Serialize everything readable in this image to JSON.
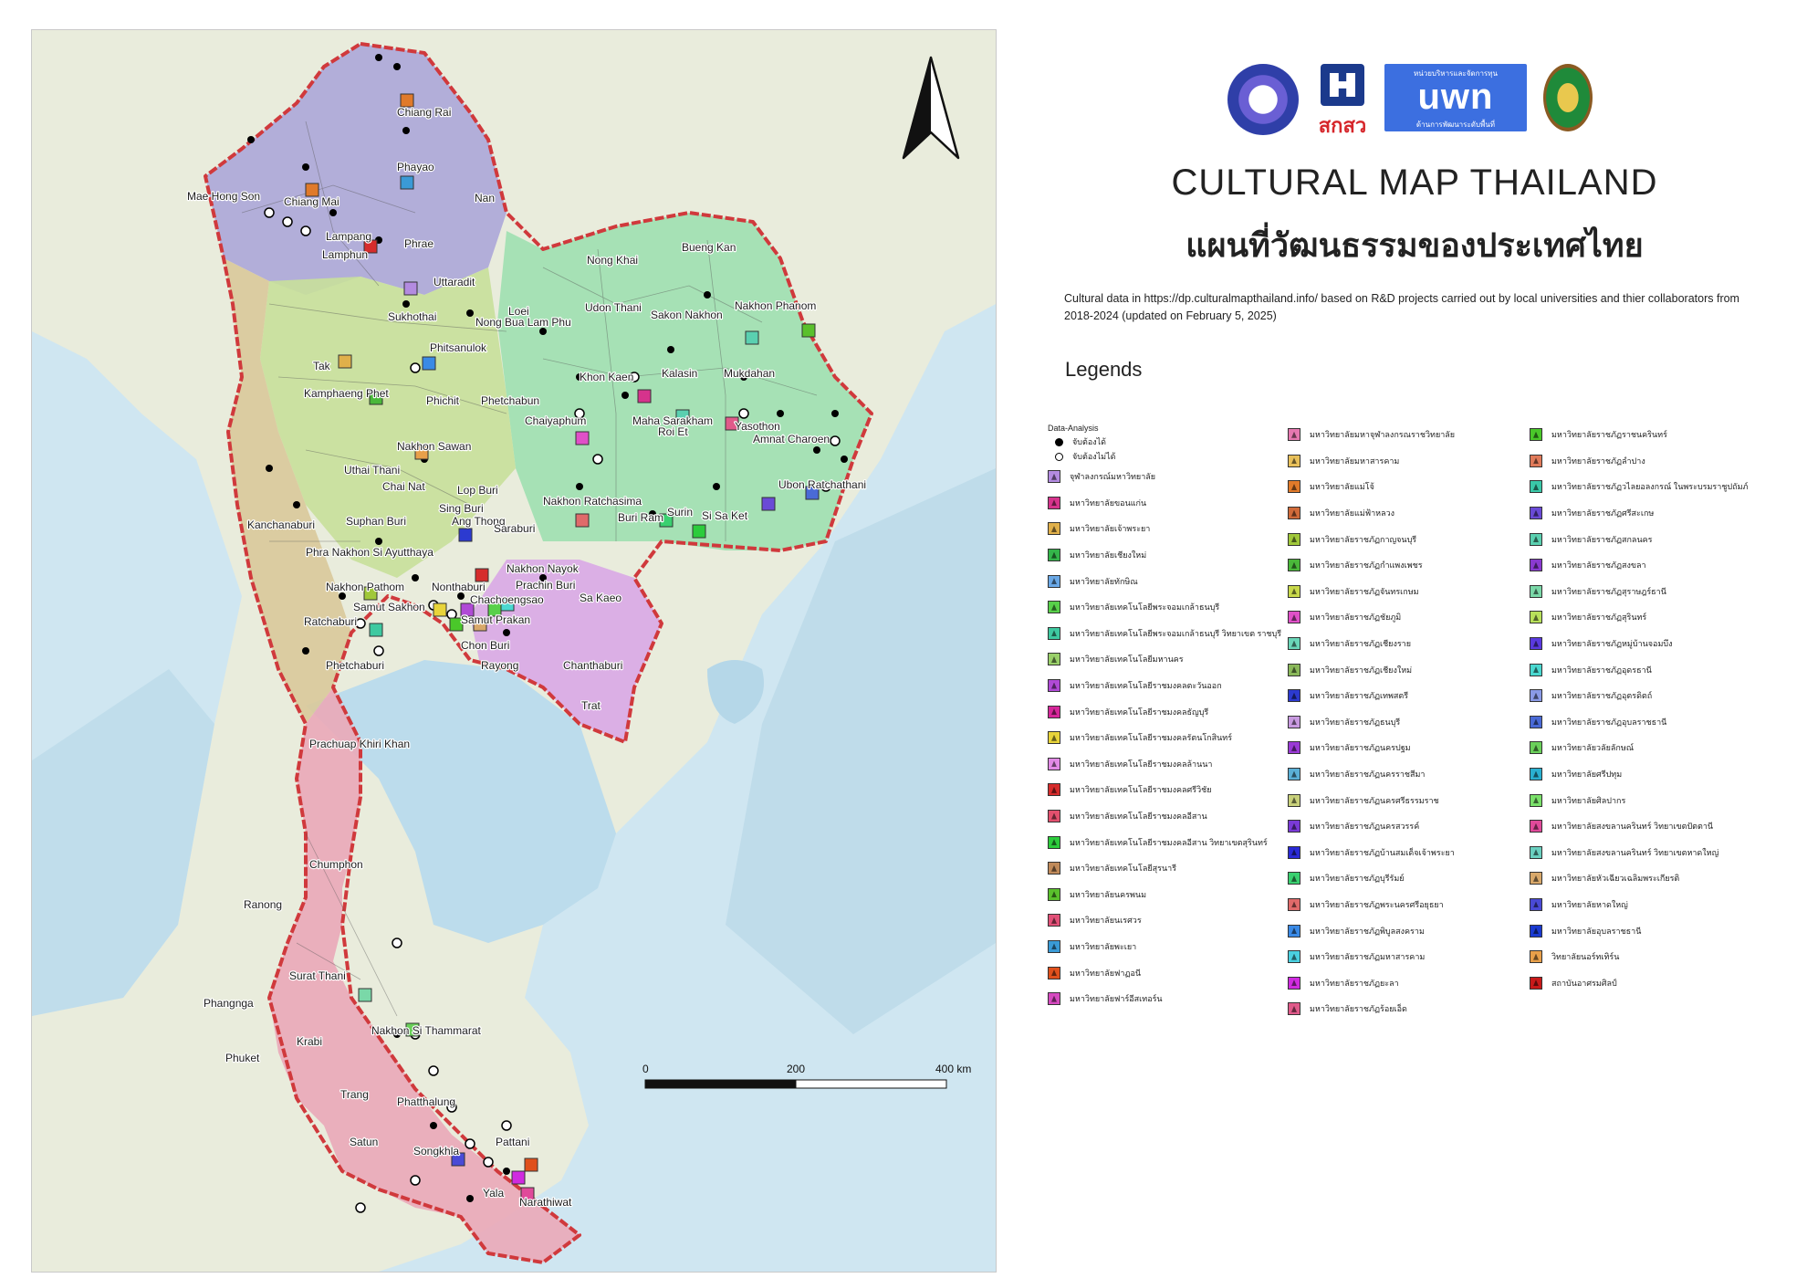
{
  "title": {
    "en": "CULTURAL MAP THAILAND",
    "th": "แผนที่วัฒนธรรมของประเทศไทย"
  },
  "description": "Cultural data in https://dp.culturalmapthailand.info/ based on R&D projects carried out by local universities and thier collaborators from 2018-2024 (updated on February 5, 2025)",
  "logos": {
    "logo2_text": "สกสว",
    "logo3_top": "หน่วยบริหารและจัดการทุน",
    "logo3_main": "uwn",
    "logo3_bottom": "ด้านการพัฒนาระดับพื้นที่"
  },
  "legend": {
    "title": "Legends",
    "data_analysis_label": "Data-Analysis",
    "tangible_label": "จับต้องได้",
    "intangible_label": "จับต้องไม่ได้",
    "columns": [
      [
        {
          "label": "จุฬาลงกรณ์มหาวิทยาลัย",
          "color": "#b38be0"
        },
        {
          "label": "มหาวิทยาลัยขอนแก่น",
          "color": "#d6338c"
        },
        {
          "label": "มหาวิทยาลัยเจ้าพระยา",
          "color": "#e0b04a"
        },
        {
          "label": "มหาวิทยาลัยเชียงใหม่",
          "color": "#34b54a"
        },
        {
          "label": "มหาวิทยาลัยทักษิณ",
          "color": "#6aa8e6"
        },
        {
          "label": "มหาวิทยาลัยเทคโนโลยีพระจอมเกล้าธนบุรี",
          "color": "#58d04a"
        },
        {
          "label": "มหาวิทยาลัยเทคโนโลยีพระจอมเกล้าธนบุรี วิทยาเขต ราชบุรี",
          "color": "#3ec9a0"
        },
        {
          "label": "มหาวิทยาลัยเทคโนโลยีมหานคร",
          "color": "#9ad06a"
        },
        {
          "label": "มหาวิทยาลัยเทคโนโลยีราชมงคลตะวันออก",
          "color": "#b04ad6"
        },
        {
          "label": "มหาวิทยาลัยเทคโนโลยีราชมงคลธัญบุรี",
          "color": "#d6269a"
        },
        {
          "label": "มหาวิทยาลัยเทคโนโลยีราชมงคลรัตนโกสินทร์",
          "color": "#e8d43a"
        },
        {
          "label": "มหาวิทยาลัยเทคโนโลยีราชมงคลล้านนา",
          "color": "#e28ae6"
        },
        {
          "label": "มหาวิทยาลัยเทคโนโลยีราชมงคลศรีวิชัย",
          "color": "#d62c2c"
        },
        {
          "label": "มหาวิทยาลัยเทคโนโลยีราชมงคลอีสาน",
          "color": "#e2506e"
        },
        {
          "label": "มหาวิทยาลัยเทคโนโลยีราชมงคลอีสาน วิทยาเขตสุรินทร์",
          "color": "#2ccc3c"
        },
        {
          "label": "มหาวิทยาลัยเทคโนโลยีสุรนารี",
          "color": "#c08a5a"
        },
        {
          "label": "มหาวิทยาลัยนครพนม",
          "color": "#5ac02c"
        },
        {
          "label": "มหาวิทยาลัยนเรศวร",
          "color": "#e25078"
        },
        {
          "label": "มหาวิทยาลัยพะเยา",
          "color": "#3a9ad6"
        },
        {
          "label": "มหาวิทยาลัยฟาฏอนี",
          "color": "#e0501c"
        },
        {
          "label": "มหาวิทยาลัยฟาร์อีสเทอร์น",
          "color": "#d64ac0"
        }
      ],
      [
        {
          "label": "มหาวิทยาลัยมหาจุฬาลงกรณราชวิทยาลัย",
          "color": "#e678b0"
        },
        {
          "label": "มหาวิทยาลัยมหาสารคาม",
          "color": "#e8c05a"
        },
        {
          "label": "มหาวิทยาลัยแม่โจ้",
          "color": "#e07a2a"
        },
        {
          "label": "มหาวิทยาลัยแม่ฟ้าหลวง",
          "color": "#d06a3a"
        },
        {
          "label": "มหาวิทยาลัยราชภัฏกาญจนบุรี",
          "color": "#a0c83a"
        },
        {
          "label": "มหาวิทยาลัยราชภัฏกำแพงเพชร",
          "color": "#4ab83a"
        },
        {
          "label": "มหาวิทยาลัยราชภัฏจันทรเกษม",
          "color": "#c8d84a"
        },
        {
          "label": "มหาวิทยาลัยราชภัฏชัยภูมิ",
          "color": "#e050c8"
        },
        {
          "label": "มหาวิทยาลัยราชภัฏเชียงราย",
          "color": "#6ad6b8"
        },
        {
          "label": "มหาวิทยาลัยราชภัฏเชียงใหม่",
          "color": "#8ab85a"
        },
        {
          "label": "มหาวิทยาลัยราชภัฏเทพสตรี",
          "color": "#2c3ad0"
        },
        {
          "label": "มหาวิทยาลัยราชภัฏธนบุรี",
          "color": "#c89ae0"
        },
        {
          "label": "มหาวิทยาลัยราชภัฏนครปฐม",
          "color": "#9a3ad6"
        },
        {
          "label": "มหาวิทยาลัยราชภัฏนครราชสีมา",
          "color": "#5ab0d6"
        },
        {
          "label": "มหาวิทยาลัยราชภัฏนครศรีธรรมราช",
          "color": "#c8d07a"
        },
        {
          "label": "มหาวิทยาลัยราชภัฏนครสวรรค์",
          "color": "#7a3ad6"
        },
        {
          "label": "มหาวิทยาลัยราชภัฏบ้านสมเด็จเจ้าพระยา",
          "color": "#2a2ad6"
        },
        {
          "label": "มหาวิทยาลัยราชภัฏบุรีรัมย์",
          "color": "#3ad070"
        },
        {
          "label": "มหาวิทยาลัยราชภัฏพระนครศรีอยุธยา",
          "color": "#e06a6a"
        },
        {
          "label": "มหาวิทยาลัยราชภัฏพิบูลสงคราม",
          "color": "#3a8ae6"
        },
        {
          "label": "มหาวิทยาลัยราชภัฏมหาสารคาม",
          "color": "#4ad0e0"
        },
        {
          "label": "มหาวิทยาลัยราชภัฏยะลา",
          "color": "#d02ae0"
        },
        {
          "label": "มหาวิทยาลัยราชภัฏร้อยเอ็ด",
          "color": "#e05a8a"
        }
      ],
      [
        {
          "label": "มหาวิทยาลัยราชภัฏราชนครินทร์",
          "color": "#4ac82a"
        },
        {
          "label": "มหาวิทยาลัยราชภัฏลำปาง",
          "color": "#e07a5a"
        },
        {
          "label": "มหาวิทยาลัยราชภัฏวไลยอลงกรณ์ ในพระบรมราชูปถัมภ์",
          "color": "#3ac8a8"
        },
        {
          "label": "มหาวิทยาลัยราชภัฏศรีสะเกษ",
          "color": "#6a4ad6"
        },
        {
          "label": "มหาวิทยาลัยราชภัฏสกลนคร",
          "color": "#5ad0b0"
        },
        {
          "label": "มหาวิทยาลัยราชภัฏสงขลา",
          "color": "#8a3ad0"
        },
        {
          "label": "มหาวิทยาลัยราชภัฏสุราษฎร์ธานี",
          "color": "#7ad8a8"
        },
        {
          "label": "มหาวิทยาลัยราชภัฏสุรินทร์",
          "color": "#b8e05a"
        },
        {
          "label": "มหาวิทยาลัยราชภัฏหมู่บ้านจอมบึง",
          "color": "#5a3ae0"
        },
        {
          "label": "มหาวิทยาลัยราชภัฏอุดรธานี",
          "color": "#4ad8d0"
        },
        {
          "label": "มหาวิทยาลัยราชภัฏอุตรดิตถ์",
          "color": "#8a9ae6"
        },
        {
          "label": "มหาวิทยาลัยราชภัฏอุบลราชธานี",
          "color": "#4a6ad6"
        },
        {
          "label": "มหาวิทยาลัยวลัยลักษณ์",
          "color": "#6ad05a"
        },
        {
          "label": "มหาวิทยาลัยศรีปทุม",
          "color": "#2ab0d0"
        },
        {
          "label": "มหาวิทยาลัยศิลปากร",
          "color": "#7ae06a"
        },
        {
          "label": "มหาวิทยาลัยสงขลานครินทร์ วิทยาเขตปัตตานี",
          "color": "#e04a9a"
        },
        {
          "label": "มหาวิทยาลัยสงขลานครินทร์ วิทยาเขตหาดใหญ่",
          "color": "#6ad0c0"
        },
        {
          "label": "มหาวิทยาลัยหัวเฉียวเฉลิมพระเกียรติ",
          "color": "#d8a86a"
        },
        {
          "label": "มหาวิทยาลัยหาดใหญ่",
          "color": "#4a4ad6"
        },
        {
          "label": "มหาวิทยาลัยอุบลราชธานี",
          "color": "#1a3ad0"
        },
        {
          "label": "วิทยาลัยนอร์ทเทิร์น",
          "color": "#e8a04a"
        },
        {
          "label": "สถาบันอาศรมศิลป์",
          "color": "#c81a1a"
        }
      ]
    ]
  },
  "map": {
    "scale_bar_labels": [
      "0",
      "200",
      "400 km"
    ],
    "place_labels": [
      "Chiang Rai",
      "Mae Hong Son",
      "Chiang Mai",
      "Phayao",
      "Nan",
      "Lampang",
      "Lamphun",
      "Phrae",
      "Uttaradit",
      "Sukhothai",
      "Tak",
      "Phitsanulok",
      "Kamphaeng Phet",
      "Phichit",
      "Phetchabun",
      "Nakhon Sawan",
      "Uthai Thani",
      "Chai Nat",
      "Lop Buri",
      "Sing Buri",
      "Ang Thong",
      "Saraburi",
      "Suphan Buri",
      "Kanchanaburi",
      "Phra Nakhon Si Ayutthaya",
      "Nakhon Nayok",
      "Prachin Buri",
      "Sa Kaeo",
      "Nakhon Pathom",
      "Nonthaburi",
      "Samut Sakhon",
      "Samut Prakan",
      "Chachoengsao",
      "Ratchaburi",
      "Phetchaburi",
      "Chon Buri",
      "Rayong",
      "Chanthaburi",
      "Trat",
      "Prachuap Khiri Khan",
      "Chumphon",
      "Ranong",
      "Surat Thani",
      "Phangnga",
      "Krabi",
      "Phuket",
      "Nakhon Si Thammarat",
      "Trang",
      "Phatthalung",
      "Satun",
      "Songkhla",
      "Pattani",
      "Yala",
      "Narathiwat",
      "Nong Khai",
      "Bueng Kan",
      "Udon Thani",
      "Sakon Nakhon",
      "Nakhon Phanom",
      "Loei",
      "Nong Bua Lam Phu",
      "Khon Kaen",
      "Kalasin",
      "Mukdahan",
      "Chaiyaphum",
      "Maha Sarakham",
      "Roi Et",
      "Yasothon",
      "Amnat Charoen",
      "Ubon Ratchathani",
      "Nakhon Ratchasima",
      "Buri Ram",
      "Surin",
      "Si Sa Ket"
    ]
  }
}
